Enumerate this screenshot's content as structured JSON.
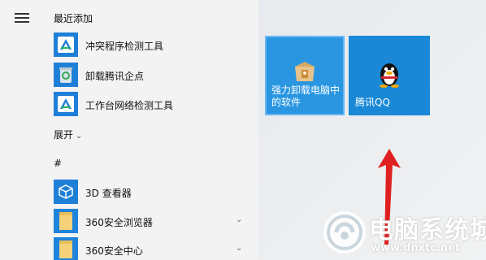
{
  "start_menu": {
    "hamburger_icon": "hamburger-menu-icon",
    "recent_header": "最近添加",
    "recent_items": [
      {
        "label": "冲突程序检测工具",
        "icon": "tool-a-icon"
      },
      {
        "label": "卸载腾讯企点",
        "icon": "recycle-bin-icon"
      },
      {
        "label": "工作台网络检测工具",
        "icon": "tool-a-icon"
      }
    ],
    "expand_label": "展开",
    "hash_header": "#",
    "apps": [
      {
        "label": "3D 查看器",
        "icon": "cube-icon"
      },
      {
        "label": "360安全浏览器",
        "icon": "folder-icon"
      },
      {
        "label": "360安全中心",
        "icon": "folder-icon"
      }
    ]
  },
  "tiles": [
    {
      "label": "强力卸载电脑中的软件",
      "icon": "uninstall-box-icon"
    },
    {
      "label": "腾讯QQ",
      "icon": "qq-penguin-icon"
    }
  ],
  "watermark": {
    "title": "电脑系统城",
    "url": "www.dnxtc.net"
  },
  "colors": {
    "tile_blue": "#1a88d6",
    "arrow_red": "#e02020"
  }
}
